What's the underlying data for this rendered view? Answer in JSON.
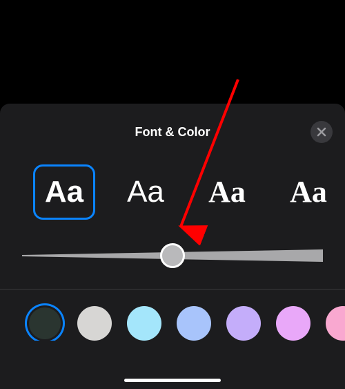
{
  "panel": {
    "title": "Font & Color"
  },
  "fonts": {
    "sample_text": "Aa",
    "options": [
      {
        "style": "sans",
        "selected": true
      },
      {
        "style": "sans-light",
        "selected": false
      },
      {
        "style": "serif",
        "selected": false
      },
      {
        "style": "serif2",
        "selected": false
      }
    ]
  },
  "slider": {
    "value_percent": 50
  },
  "colors": {
    "options": [
      {
        "hex": "#2a3530",
        "selected": true
      },
      {
        "hex": "#d7d6d4",
        "selected": false
      },
      {
        "hex": "#a4e6fb",
        "selected": false
      },
      {
        "hex": "#a8c4fb",
        "selected": false
      },
      {
        "hex": "#c4adfa",
        "selected": false
      },
      {
        "hex": "#e9a8f9",
        "selected": false
      },
      {
        "hex": "#f9a8d0",
        "selected": false
      }
    ]
  },
  "annotation": {
    "color": "#ff0000"
  }
}
